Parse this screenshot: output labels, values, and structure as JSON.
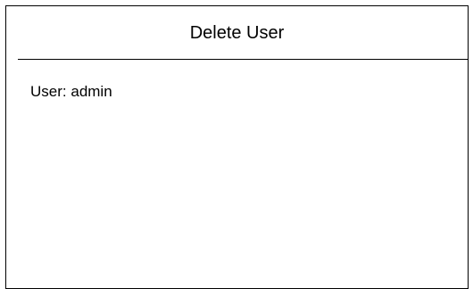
{
  "dialog": {
    "title": "Delete User",
    "user_label": "User:",
    "user_value": "admin"
  }
}
